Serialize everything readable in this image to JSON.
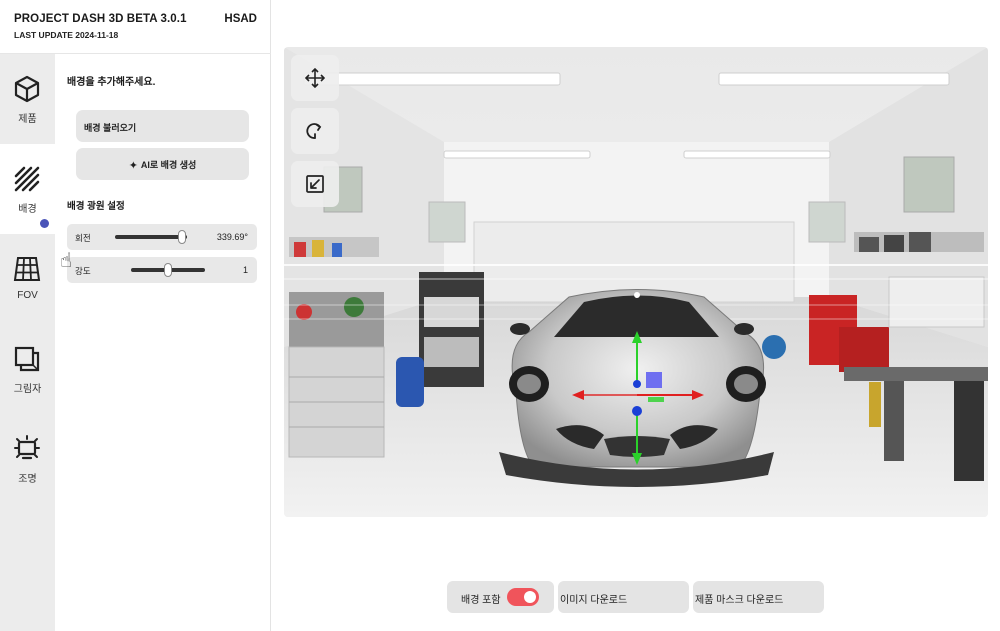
{
  "header": {
    "app_title": "PROJECT DASH 3D BETA 3.0.1",
    "last_update": "LAST UPDATE 2024-11-18",
    "company": "HSAD"
  },
  "nav": {
    "items": [
      {
        "label": "제품",
        "icon": "cube-icon"
      },
      {
        "label": "배경",
        "icon": "diagonal-lines-icon"
      },
      {
        "label": "FOV",
        "icon": "grid-icon"
      },
      {
        "label": "그림자",
        "icon": "shadow-icon"
      },
      {
        "label": "조명",
        "icon": "light-icon"
      }
    ],
    "active": "배경"
  },
  "background_panel": {
    "prompt": "배경을 추가해주세요.",
    "load_button": "배경 불러오기",
    "ai_button": "AI로 배경 생성",
    "light_title": "배경 광원 설정",
    "rotation": {
      "label": "회전",
      "value": "339.69°",
      "fraction": 0.94
    },
    "intensity": {
      "label": "강도",
      "value": "1",
      "fraction": 0.5
    }
  },
  "tools": {
    "items": [
      "move-icon",
      "rotate-icon",
      "scale-icon"
    ]
  },
  "bottom": {
    "include_background_label": "배경 포함",
    "include_background_on": true,
    "download_image": "이미지 다운로드",
    "download_mask": "제품 마스크 다운로드"
  },
  "colors": {
    "accent_toggle": "#f0545b",
    "nav_dot": "#4a54b8",
    "gizmo_y": "#2ad12a",
    "gizmo_x": "#e02020",
    "gizmo_z": "#1a3fd6"
  }
}
